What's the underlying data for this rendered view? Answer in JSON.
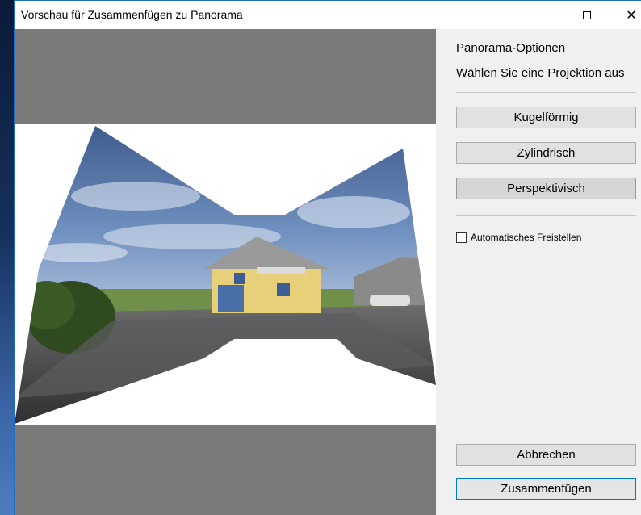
{
  "window": {
    "title": "Vorschau für Zusammenfügen zu Panorama"
  },
  "titlebar_buttons": {
    "minimize_icon": "minimize-icon",
    "maximize_icon": "maximize-icon",
    "close_icon": "close-icon",
    "close_glyph": "✕"
  },
  "options": {
    "heading": "Panorama-Optionen",
    "projection_prompt": "Wählen Sie eine Projektion aus",
    "projections": [
      {
        "label": "Kugelförmig",
        "selected": false
      },
      {
        "label": "Zylindrisch",
        "selected": false
      },
      {
        "label": "Perspektivisch",
        "selected": true
      }
    ],
    "auto_crop": {
      "label": "Automatisches Freistellen",
      "checked": false
    },
    "cancel_label": "Abbrechen",
    "merge_label": "Zusammenfügen"
  },
  "colors": {
    "preview_background": "#7a7a7a",
    "accent": "#0078d7"
  }
}
